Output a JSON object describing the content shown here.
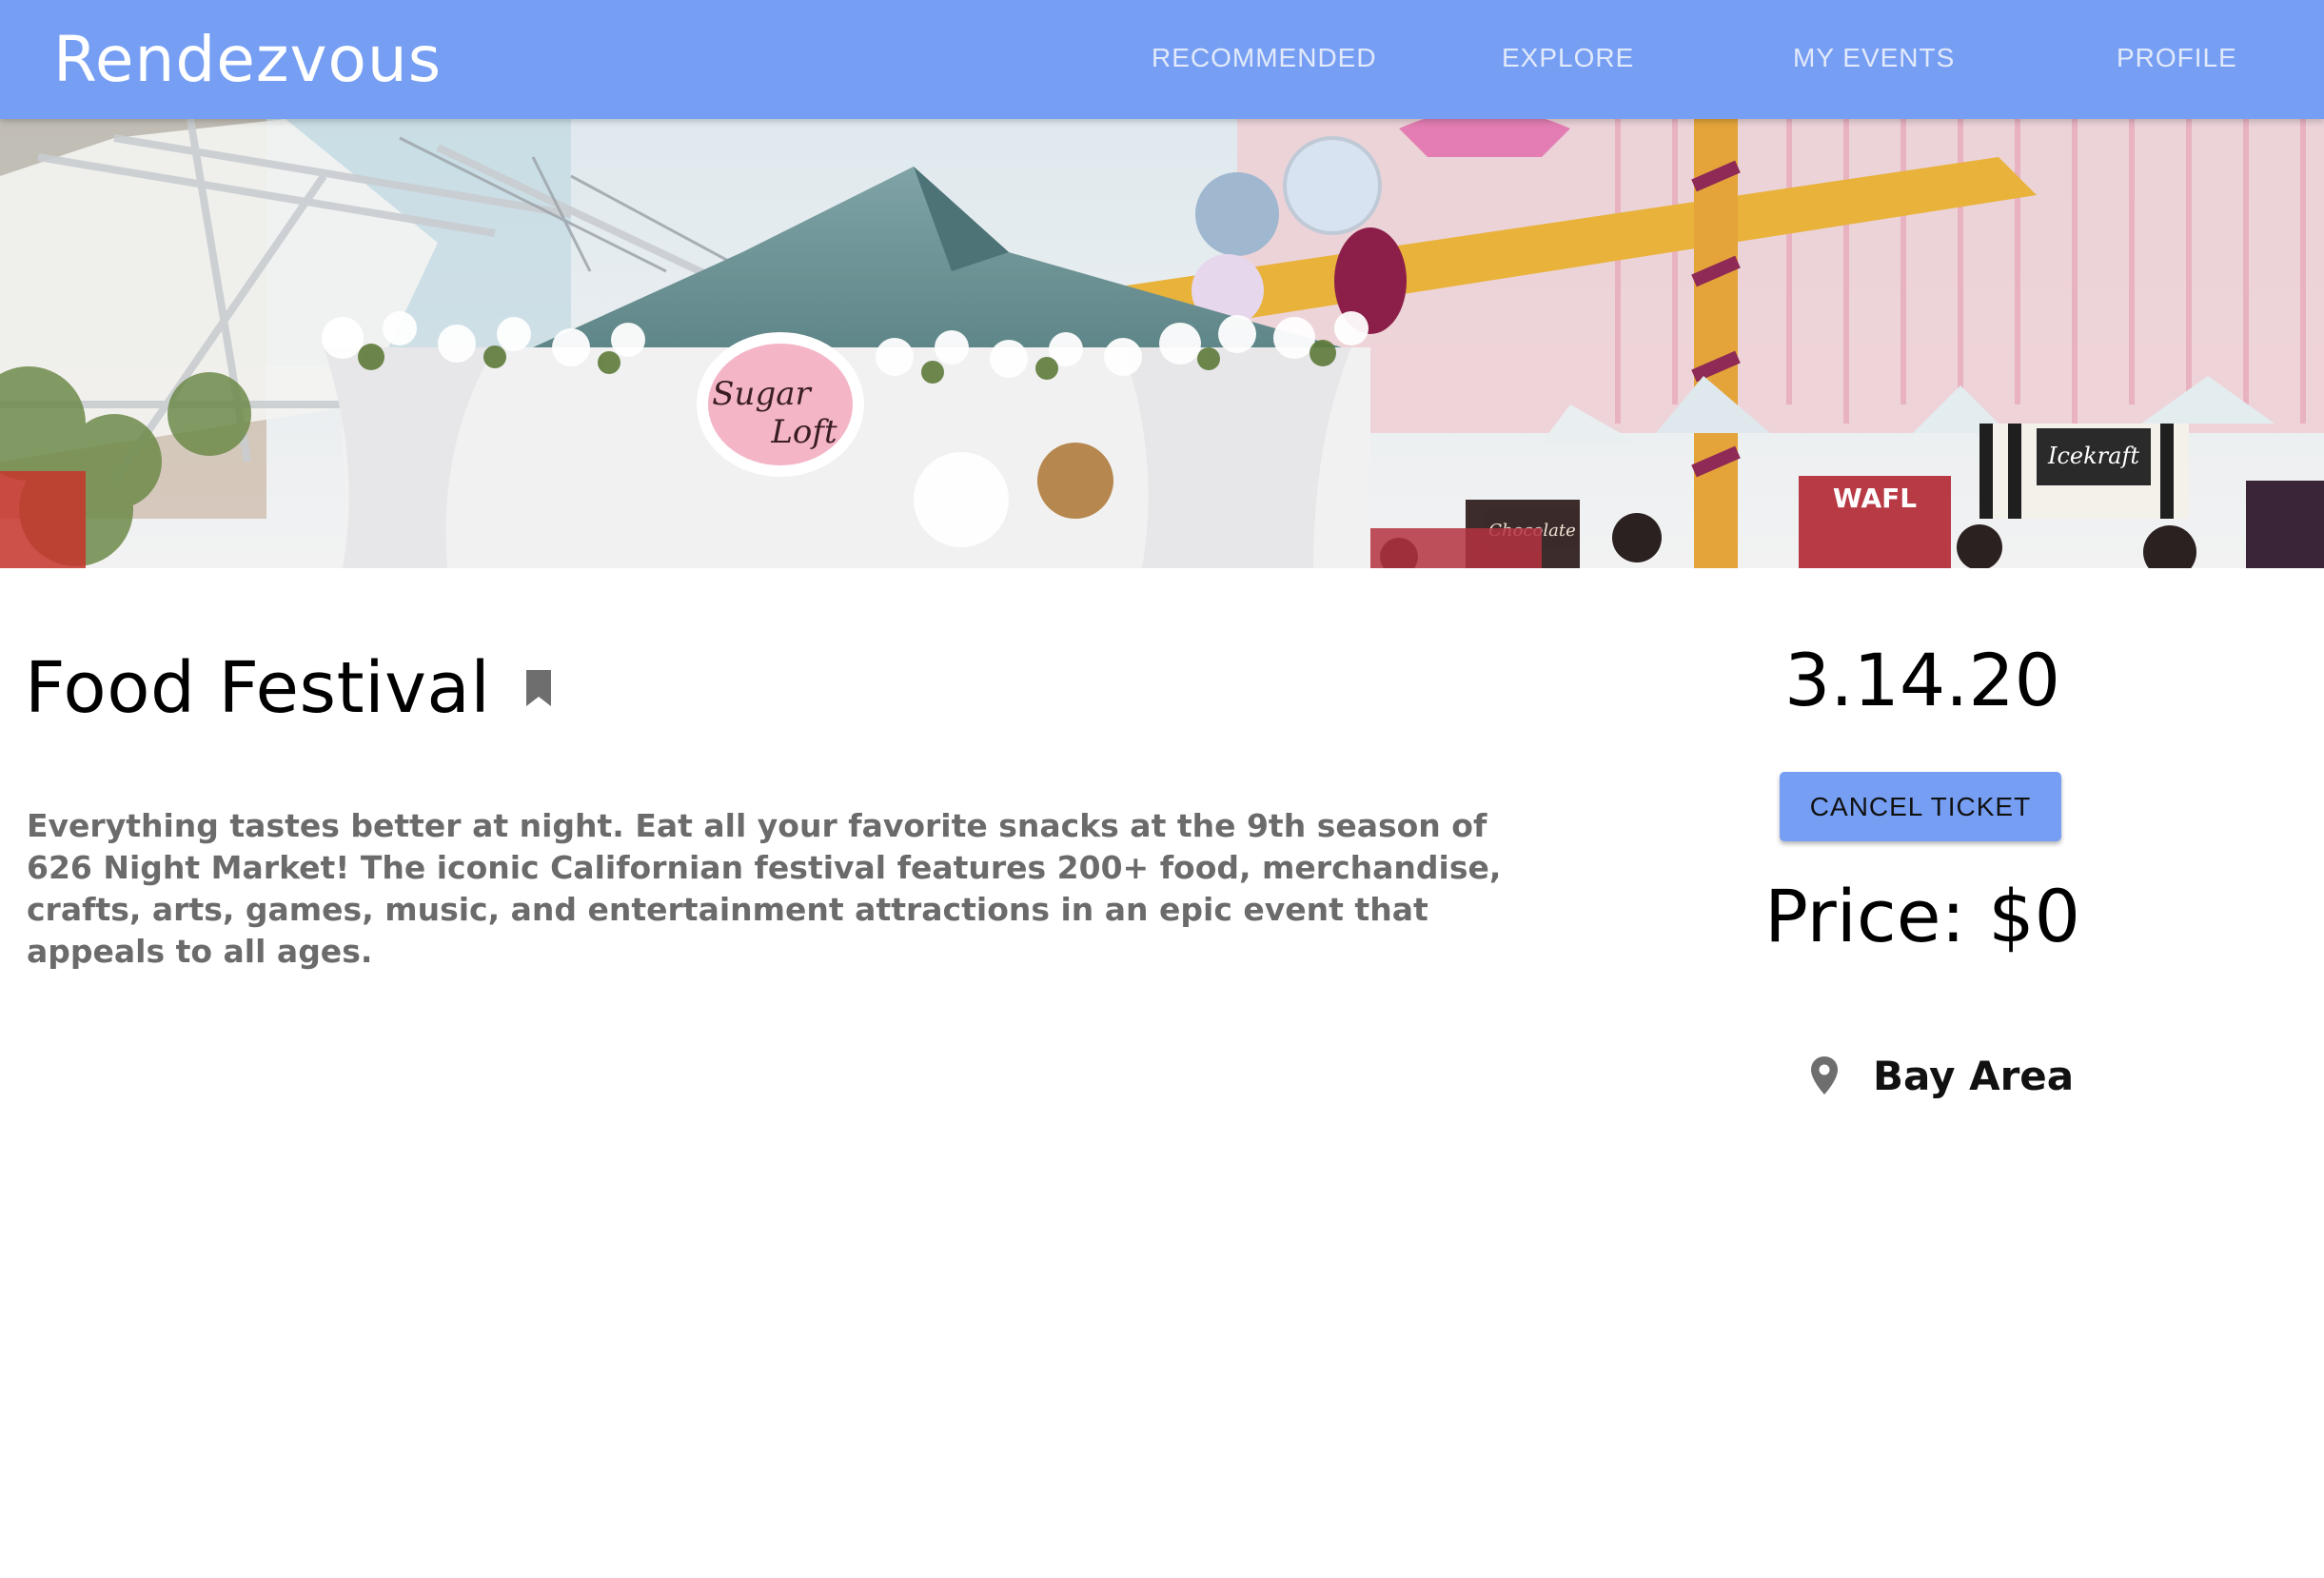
{
  "nav": {
    "brand": "Rendezvous",
    "links": [
      {
        "label": "RECOMMENDED"
      },
      {
        "label": "EXPLORE"
      },
      {
        "label": "MY EVENTS"
      },
      {
        "label": "PROFILE"
      }
    ]
  },
  "hero": {
    "signs": {
      "sugar_loft_line1": "Sugar",
      "sugar_loft_line2": "Loft",
      "wafl": "WAFL",
      "icekraft": "Icekraft",
      "chocolate": "Chocolate"
    }
  },
  "event": {
    "title": "Food Festival",
    "description": "Everything tastes better at night. Eat all your favorite snacks at the 9th season of 626 Night Market! The iconic Californian festival features 200+ food, merchandise, crafts, arts, games, music, and entertainment attractions in an epic event that appeals to all ages.",
    "date": "3.14.20",
    "cancel_label": "CANCEL TICKET",
    "price": "Price: $0",
    "location": "Bay Area"
  },
  "colors": {
    "nav_background": "#769ff4",
    "button_background": "#769ff4",
    "description_text": "#6b6b6b",
    "icon_grey": "#6e6e6e"
  },
  "icons": {
    "bookmark": "bookmark-icon",
    "location": "location-pin-icon"
  }
}
